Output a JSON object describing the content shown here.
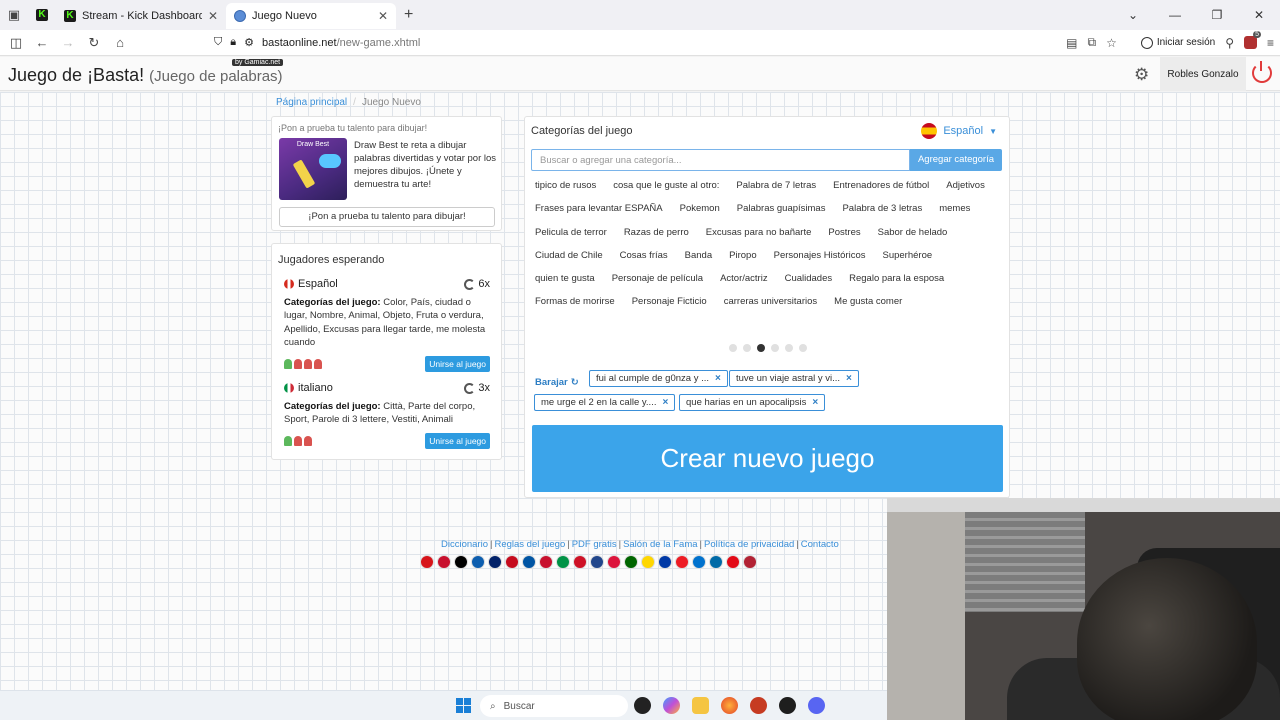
{
  "browser": {
    "tabs": [
      {
        "label": "",
        "type": "kick-pinned"
      },
      {
        "label": "Stream - Kick Dashboard",
        "active": false
      },
      {
        "label": "Juego Nuevo",
        "active": true
      }
    ],
    "url_host": "bastaonline.net",
    "url_path": "/new-game.xhtml",
    "login_label": "Iniciar sesión"
  },
  "header": {
    "title": "Juego de ¡Basta!",
    "subtitle": "(Juego de palabras)",
    "badge": "by Gamiac.net",
    "user": "Robles Gonzalo"
  },
  "breadcrumb": {
    "home": "Página principal",
    "current": "Juego Nuevo"
  },
  "promo": {
    "heading": "¡Pon a prueba tu talento para dibujar!",
    "image_title": "Draw Best",
    "text": "Draw Best te reta a dibujar palabras divertidas y votar por los mejores dibujos. ¡Únete y demuestra tu arte!",
    "button": "¡Pon a prueba tu talento para dibujar!"
  },
  "players": {
    "title": "Jugadores esperando",
    "games": [
      {
        "language": "Español",
        "count": "6x",
        "cats_label": "Categorías del juego:",
        "cats": " Color, País, ciudad o lugar, Nombre, Animal, Objeto, Fruta o verdura, Apellido, Excusas para llegar tarde, me molesta cuando",
        "join": "Unirse al juego",
        "players_icons": [
          "green",
          "red",
          "red",
          "red"
        ]
      },
      {
        "language": "italiano",
        "count": "3x",
        "cats_label": "Categorías del juego:",
        "cats": " Città, Parte del corpo, Sport, Parole di 3 lettere, Vestiti, Animali",
        "join": "Unirse al juego",
        "players_icons": [
          "green",
          "red",
          "red"
        ]
      }
    ]
  },
  "categories": {
    "title": "Categorías del juego",
    "language": "Español",
    "search_placeholder": "Buscar o agregar una categoría...",
    "add_button": "Agregar categoría",
    "suggestions": [
      "tipico de rusos",
      "cosa que le guste al otro:",
      "Palabra de 7 letras",
      "Entrenadores de fútbol",
      "Adjetivos",
      "Frases para levantar ESPAÑA",
      "Pokemon",
      "Palabras guapísimas",
      "Palabra de 3 letras",
      "memes",
      "Pelicula de terror",
      "Razas de perro",
      "Excusas para no bañarte",
      "Postres",
      "Sabor de helado",
      "Ciudad de Chile",
      "Cosas frías",
      "Banda",
      "Piropo",
      "Personajes Históricos",
      "Superhéroe",
      "quien te gusta",
      "Personaje de película",
      "Actor/actriz",
      "Cualidades",
      "Regalo para la esposa",
      "Formas de morirse",
      "Personaje Ficticio",
      "carreras universitarios",
      "Me gusta comer"
    ],
    "page_dots": 6,
    "active_dot": 3,
    "shuffle_label": "Barajar",
    "selected": [
      "fui al cumple de g0nza y ...",
      "tuve un viaje astral y vi...",
      "me urge el 2 en la calle y....",
      "que harias en un apocalipsis"
    ],
    "create_button": "Crear nuevo juego"
  },
  "footer": {
    "links": [
      "Diccionario",
      "Reglas del juego",
      "PDF gratis",
      "Salón de la Fama",
      "Política de privacidad",
      "Contacto"
    ],
    "flag_colors": [
      "#d7141a",
      "#c8102e",
      "#000000",
      "#0d5eaf",
      "#012169",
      "#c60b1e",
      "#0055a4",
      "#c8102e",
      "#009246",
      "#ce1126",
      "#21468b",
      "#dc143c",
      "#006600",
      "#ffd700",
      "#0039a6",
      "#ee1c25",
      "#0072ce",
      "#006aa7",
      "#e30a17",
      "#b22234"
    ]
  },
  "taskbar": {
    "search_placeholder": "Buscar"
  },
  "colors": {
    "accent": "#3ba4ea",
    "link": "#3a8fd8",
    "danger": "#e13b3b"
  }
}
